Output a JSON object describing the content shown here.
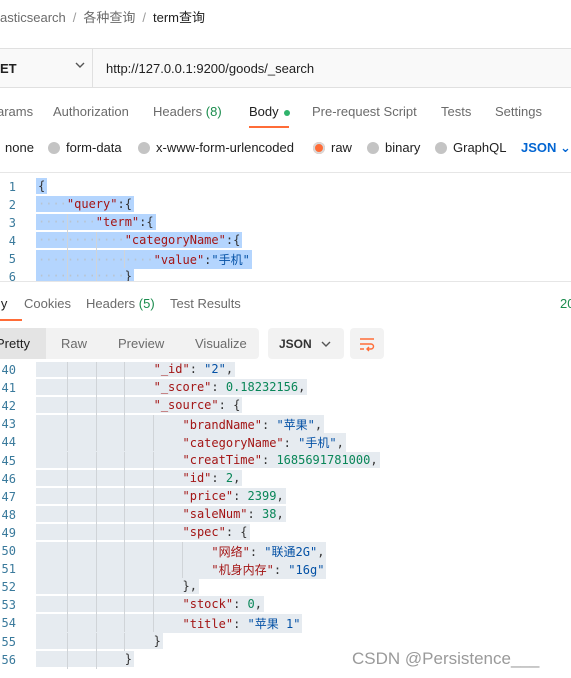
{
  "breadcrumb": [
    "asticsearch",
    "各种查询",
    "term查询"
  ],
  "request": {
    "method": "ET",
    "url": "http://127.0.0.1:9200/goods/_search"
  },
  "tabs": [
    {
      "label": "arams"
    },
    {
      "label": "Authorization"
    },
    {
      "label": "Headers",
      "count": "(8)"
    },
    {
      "label": "Body"
    },
    {
      "label": "Pre-request Script"
    },
    {
      "label": "Tests"
    },
    {
      "label": "Settings"
    }
  ],
  "body_types": [
    {
      "label": "none"
    },
    {
      "label": "form-data"
    },
    {
      "label": "x-www-form-urlencoded"
    },
    {
      "label": "raw",
      "selected": true
    },
    {
      "label": "binary"
    },
    {
      "label": "GraphQL"
    }
  ],
  "body_format": "JSON",
  "request_code": [
    {
      "n": "1",
      "i": 0,
      "t": [
        [
          "p",
          "{"
        ]
      ]
    },
    {
      "n": "2",
      "i": 1,
      "t": [
        [
          "k",
          "\"query\""
        ],
        [
          "p",
          ":{"
        ]
      ]
    },
    {
      "n": "3",
      "i": 2,
      "t": [
        [
          "k",
          "\"term\""
        ],
        [
          "p",
          ":{"
        ]
      ]
    },
    {
      "n": "4",
      "i": 3,
      "t": [
        [
          "k",
          "\"categoryName\""
        ],
        [
          "p",
          ":{"
        ]
      ]
    },
    {
      "n": "5",
      "i": 4,
      "t": [
        [
          "k",
          "\"value\""
        ],
        [
          "p",
          ":"
        ],
        [
          "s",
          "\"手机\""
        ]
      ]
    },
    {
      "n": "6",
      "i": 3,
      "t": [
        [
          "p",
          "}"
        ]
      ]
    }
  ],
  "response_tabs": [
    {
      "label": "ly"
    },
    {
      "label": "Cookies"
    },
    {
      "label": "Headers",
      "count": "(5)"
    },
    {
      "label": "Test Results"
    }
  ],
  "status_code": "20",
  "view_modes": [
    "Pretty",
    "Raw",
    "Preview",
    "Visualize"
  ],
  "response_format": "JSON",
  "response_code": [
    {
      "n": "40",
      "i": 4,
      "t": [
        [
          "k",
          "\"_id\""
        ],
        [
          "p",
          ": "
        ],
        [
          "s",
          "\"2\""
        ],
        [
          "p",
          ","
        ]
      ]
    },
    {
      "n": "41",
      "i": 4,
      "t": [
        [
          "k",
          "\"_score\""
        ],
        [
          "p",
          ": "
        ],
        [
          "n",
          "0.18232156"
        ],
        [
          "p",
          ","
        ]
      ]
    },
    {
      "n": "42",
      "i": 4,
      "t": [
        [
          "k",
          "\"_source\""
        ],
        [
          "p",
          ": {"
        ]
      ]
    },
    {
      "n": "43",
      "i": 5,
      "t": [
        [
          "k",
          "\"brandName\""
        ],
        [
          "p",
          ": "
        ],
        [
          "s",
          "\"苹果\""
        ],
        [
          "p",
          ","
        ]
      ]
    },
    {
      "n": "44",
      "i": 5,
      "t": [
        [
          "k",
          "\"categoryName\""
        ],
        [
          "p",
          ": "
        ],
        [
          "s",
          "\"手机\""
        ],
        [
          "p",
          ","
        ]
      ]
    },
    {
      "n": "45",
      "i": 5,
      "t": [
        [
          "k",
          "\"creatTime\""
        ],
        [
          "p",
          ": "
        ],
        [
          "n",
          "1685691781000"
        ],
        [
          "p",
          ","
        ]
      ]
    },
    {
      "n": "46",
      "i": 5,
      "t": [
        [
          "k",
          "\"id\""
        ],
        [
          "p",
          ": "
        ],
        [
          "n",
          "2"
        ],
        [
          "p",
          ","
        ]
      ]
    },
    {
      "n": "47",
      "i": 5,
      "t": [
        [
          "k",
          "\"price\""
        ],
        [
          "p",
          ": "
        ],
        [
          "n",
          "2399"
        ],
        [
          "p",
          ","
        ]
      ]
    },
    {
      "n": "48",
      "i": 5,
      "t": [
        [
          "k",
          "\"saleNum\""
        ],
        [
          "p",
          ": "
        ],
        [
          "n",
          "38"
        ],
        [
          "p",
          ","
        ]
      ]
    },
    {
      "n": "49",
      "i": 5,
      "t": [
        [
          "k",
          "\"spec\""
        ],
        [
          "p",
          ": {"
        ]
      ]
    },
    {
      "n": "50",
      "i": 6,
      "t": [
        [
          "k",
          "\"网络\""
        ],
        [
          "p",
          ": "
        ],
        [
          "s",
          "\"联通2G\""
        ],
        [
          "p",
          ","
        ]
      ]
    },
    {
      "n": "51",
      "i": 6,
      "t": [
        [
          "k",
          "\"机身内存\""
        ],
        [
          "p",
          ": "
        ],
        [
          "s",
          "\"16g\""
        ]
      ]
    },
    {
      "n": "52",
      "i": 5,
      "t": [
        [
          "p",
          "},"
        ]
      ]
    },
    {
      "n": "53",
      "i": 5,
      "t": [
        [
          "k",
          "\"stock\""
        ],
        [
          "p",
          ": "
        ],
        [
          "n",
          "0"
        ],
        [
          "p",
          ","
        ]
      ]
    },
    {
      "n": "54",
      "i": 5,
      "t": [
        [
          "k",
          "\"title\""
        ],
        [
          "p",
          ": "
        ],
        [
          "s",
          "\"苹果 1\""
        ]
      ]
    },
    {
      "n": "55",
      "i": 4,
      "t": [
        [
          "p",
          "}"
        ]
      ]
    },
    {
      "n": "56",
      "i": 3,
      "t": [
        [
          "p",
          "}"
        ]
      ]
    }
  ],
  "watermark": "CSDN @Persistence___",
  "colors": {
    "accent": "#ff6c37",
    "link": "#0265d2",
    "success": "#1a8c4d",
    "selection": "#b4d5fe"
  }
}
